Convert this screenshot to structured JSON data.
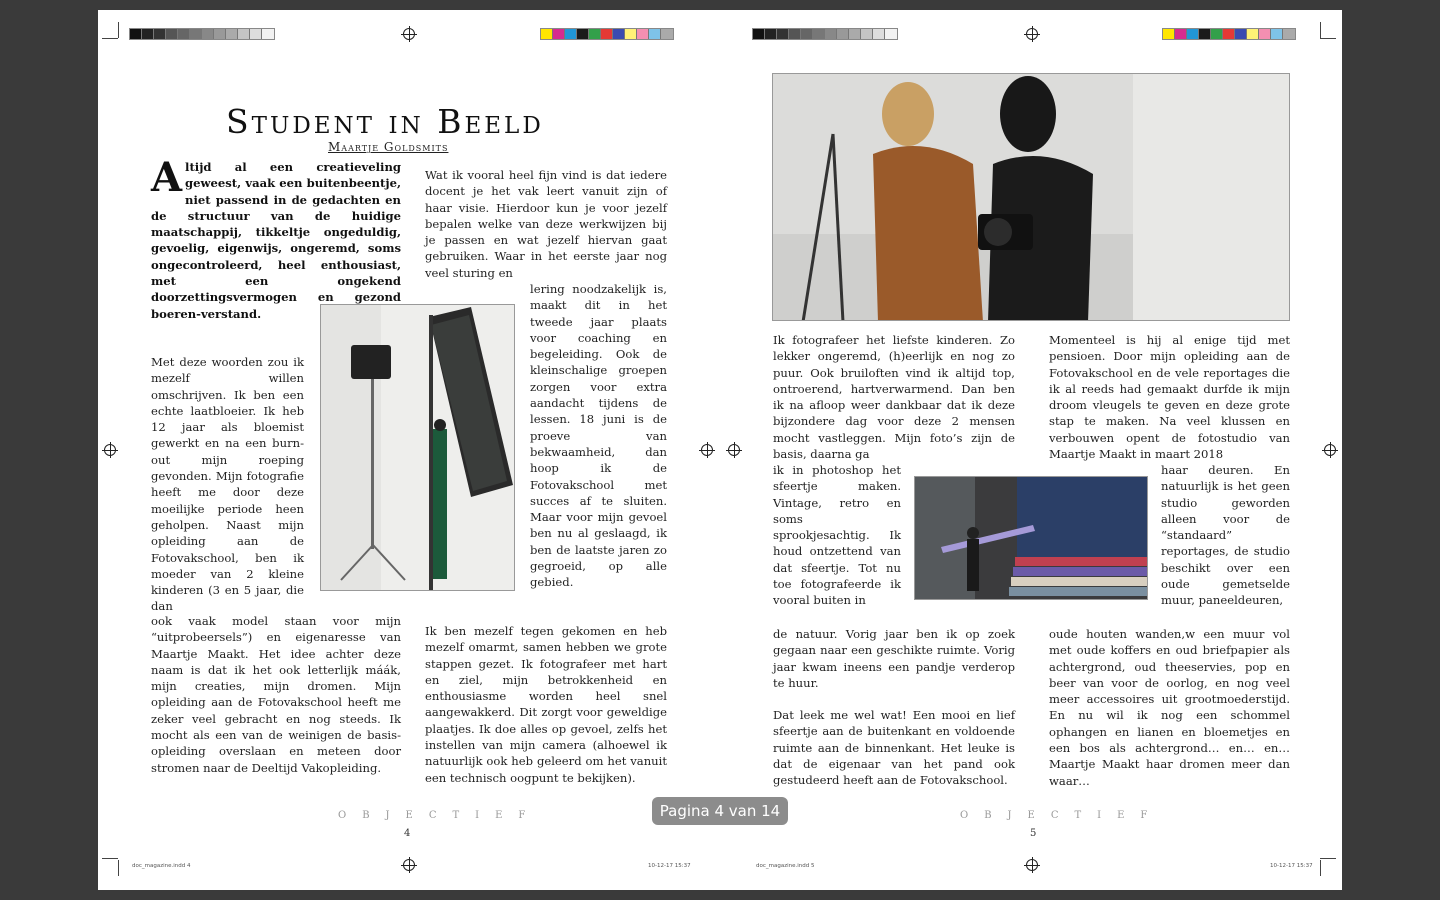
{
  "viewer": {
    "pager": "Pagina 4 van 14"
  },
  "colors": {
    "grey_bar": [
      "#111111",
      "#222222",
      "#333333",
      "#555555",
      "#666666",
      "#777777",
      "#888888",
      "#999999",
      "#aaaaaa",
      "#c4c4c4",
      "#dddddd",
      "#f2f2f2"
    ],
    "color_bar": [
      "#ffe600",
      "#d62b8f",
      "#2196d6",
      "#1a1a1a",
      "#33a04a",
      "#e53935",
      "#3a4bb0",
      "#fff176",
      "#f48fb1",
      "#7ec3e8",
      "#aaaaaa"
    ]
  },
  "left_page": {
    "title": "Student in Beeld",
    "byline": "Maartje Goldsmits",
    "dropcap": "A",
    "lead": "ltijd al een creatieveling geweest, vaak een buitenbeentje, niet passend in de gedachten en de structuur van de huidige maatschappij, tikkeltje ongeduldig, gevoelig, eigenwijs, ongeremd, soms ongecontroleerd, heel enthousiast, met een ongekend doorzettingsvermogen en gezond boeren-verstand.",
    "col1_a": "Met deze woorden zou ik mezelf willen omschrijven. Ik ben een echte laatbloeier. Ik heb 12 jaar als bloemist gewerkt en na een burn-out mijn roeping gevonden. Mijn fotografie heeft me door deze moeilijke periode heen geholpen. Naast mijn opleiding aan de Fotovakschool, ben ik moeder van 2 kleine kinderen (3 en 5 jaar, die dan",
    "col1_b": "ook vaak model staan voor mijn “uitprobeersels”) en eigenaresse van Maartje Maakt. Het idee achter deze naam is dat ik het ook letterlijk máák, mijn creaties, mijn dromen. Mijn opleiding aan de Fotovakschool heeft me zeker veel gebracht en nog steeds. Ik mocht als een van de weinigen de basis-opleiding overslaan en meteen door stromen naar de Deeltijd Vakopleiding.",
    "col2_a": "Wat ik vooral heel fijn vind is dat iedere docent je het vak leert vanuit zijn of haar visie. Hierdoor kun je voor jezelf bepalen welke van deze werkwijzen bij je passen en wat jezelf hiervan gaat gebruiken. Waar in het eerste jaar nog veel sturing en",
    "col2_b": "lering noodzakelijk is, maakt dit in het tweede jaar plaats voor coaching en begeleiding. Ook de kleinschalige groepen zorgen voor extra aandacht tijdens de lessen. 18 juni is de proeve van bekwaamheid, dan hoop ik de Fotovakschool met succes af te sluiten. Maar voor mijn gevoel ben nu al geslaagd, ik ben de laatste jaren zo gegroeid, op alle gebied.",
    "col2_c": "Ik ben mezelf tegen gekomen en heb mezelf omarmt, samen hebben we grote stappen gezet. Ik fotografeer met hart en ziel, mijn betrokkenheid en enthousiasme worden heel snel aangewakkerd. Dit zorgt voor geweldige plaatjes. Ik doe alles op gevoel, zelfs het instellen van mijn camera (alhoewel ik natuurlijk ook heb geleerd om het vanuit een technisch oogpunt te bekijken).",
    "footer_word": "OBJECTIEF",
    "page_number": "4",
    "slug_left": "doc_magazine.indd   4",
    "slug_right": "10-12-17   15:37"
  },
  "right_page": {
    "col1_a": "Ik fotografeer het liefste kinderen. Zo lekker ongeremd, (h)eerlijk en nog zo puur. Ook bruiloften vind ik altijd top, ontroerend, hartverwarmend. Dan ben ik na afloop weer dankbaar dat ik deze bijzondere dag voor deze 2 mensen mocht vastleggen. Mijn foto’s zijn de basis, daarna ga",
    "col1_b": "ik in photoshop het sfeertje maken. Vintage, retro en soms sprookjesachtig. Ik houd ontzettend van dat sfeertje. Tot nu toe fotografeerde ik vooral buiten in",
    "col1_c": "de natuur. Vorig jaar ben ik op zoek gegaan naar een geschikte ruimte. Vorig jaar kwam ineens een pandje verderop te huur.",
    "col1_d": "Dat leek me wel wat! Een mooi en lief sfeertje aan de buitenkant en voldoende ruimte aan de binnenkant. Het leuke is dat de eigenaar van het pand ook gestudeerd heeft aan de Fotovakschool.",
    "col2_a": "Momenteel is hij al enige tijd met pensioen. Door mijn opleiding aan de Fotovakschool en de vele reportages die ik al reeds had gemaakt durfde ik mijn droom vleugels te geven en deze grote stap te maken. Na veel klussen en verbouwen opent de fotostudio van Maartje Maakt in maart 2018",
    "col2_b": "haar deuren. En natuurlijk is het geen studio geworden alleen voor de “standaard” reportages, de studio beschikt over een oude gemetselde muur, paneeldeuren,",
    "col2_c": "oude houten wanden,w een muur vol met oude koffers en oud briefpapier als achtergrond, oud theeservies, pop en beer van voor de oorlog, en nog veel meer accessoires uit grootmoederstijd. En nu wil ik nog een schommel ophangen en lianen en bloemetjes en een bos als achtergrond… en… en… Maartje Maakt haar dromen meer dan waar…",
    "footer_word": "OBJECTIEF",
    "page_number": "5",
    "slug_left": "doc_magazine.indd   5",
    "slug_right": "10-12-17   15:37"
  }
}
